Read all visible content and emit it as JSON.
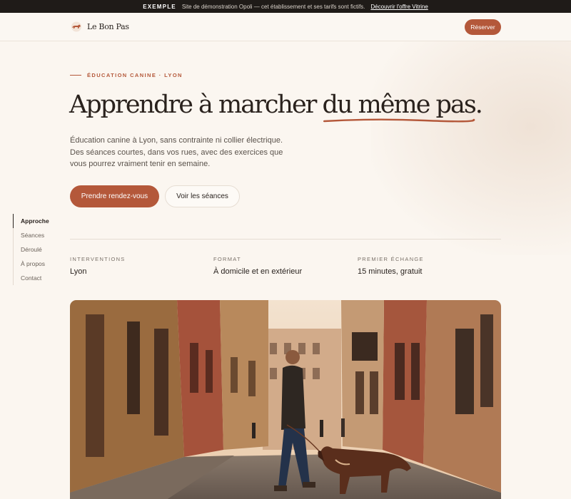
{
  "banner": {
    "tag": "EXEMPLE",
    "text": "Site de démonstration Opoli — cet établissement et ses tarifs sont fictifs.",
    "link": "Découvrir l'offre Vitrine"
  },
  "header": {
    "logo_text": "Le Bon Pas",
    "reserve_label": "Réserver"
  },
  "hero": {
    "eyebrow": "ÉDUCATION CANINE · LYON",
    "title_main": "Apprendre à marcher ",
    "title_accent": "du même pas",
    "title_end": ".",
    "description": "Éducation canine à Lyon, sans contrainte ni collier électrique. Des séances courtes, dans vos rues, avec des exercices que vous pourrez vraiment tenir en semaine.",
    "primary_cta": "Prendre rendez-vous",
    "secondary_cta": "Voir les séances"
  },
  "sidenav": {
    "items": [
      {
        "label": "Approche",
        "active": true
      },
      {
        "label": "Séances",
        "active": false
      },
      {
        "label": "Déroulé",
        "active": false
      },
      {
        "label": "À propos",
        "active": false
      },
      {
        "label": "Contact",
        "active": false
      }
    ]
  },
  "facts": [
    {
      "label": "INTERVENTIONS",
      "value": "Lyon"
    },
    {
      "label": "FORMAT",
      "value": "À domicile et en extérieur"
    },
    {
      "label": "PREMIER ÉCHANGE",
      "value": "15 minutes, gratuit"
    }
  ],
  "colors": {
    "accent": "#b4583a",
    "background": "#fbf6f0",
    "banner": "#1f1b18",
    "text": "#2b2420"
  }
}
